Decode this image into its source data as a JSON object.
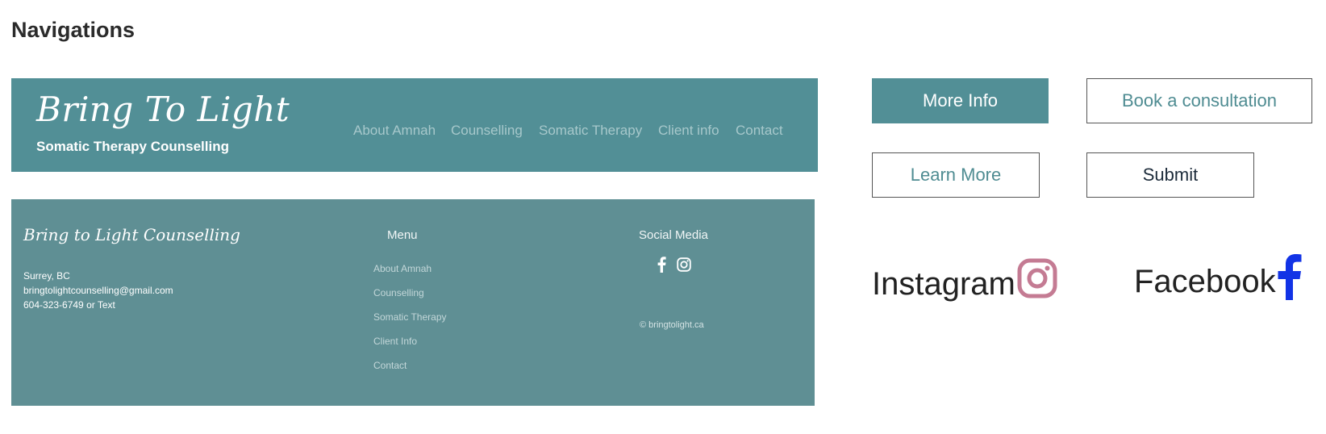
{
  "page": {
    "title": "Navigations"
  },
  "header": {
    "brand_script": "Bring To Light",
    "brand_subtitle": "Somatic Therapy Counselling",
    "nav": [
      "About Amnah",
      "Counselling",
      "Somatic Therapy",
      "Client info",
      "Contact"
    ],
    "background": "#528f96"
  },
  "footer": {
    "brand_script": "Bring to Light Counselling",
    "contact": [
      "Surrey, BC",
      "bringtolightcounselling@gmail.com",
      "604-323-6749 or Text"
    ],
    "menu_heading": "Menu",
    "menu_items": [
      "About Amnah",
      "Counselling",
      "Somatic Therapy",
      "Client Info",
      "Contact"
    ],
    "social_heading": "Social Media",
    "social_icons": [
      "facebook-icon",
      "instagram-icon"
    ],
    "copyright": "© bringtolight.ca",
    "background": "#5f8f94"
  },
  "buttons": {
    "more_info": "More Info",
    "book_consultation": "Book a consultation",
    "learn_more": "Learn More",
    "submit": "Submit"
  },
  "social_links": {
    "instagram_label": "Instagram",
    "facebook_label": "Facebook",
    "instagram_icon_color": "#c47b93",
    "facebook_icon_color": "#1233e6"
  },
  "colors": {
    "accent": "#528f96",
    "book_text": "#4f8c92",
    "learn_text": "#4f8c92",
    "submit_text": "#1c2b3a"
  }
}
